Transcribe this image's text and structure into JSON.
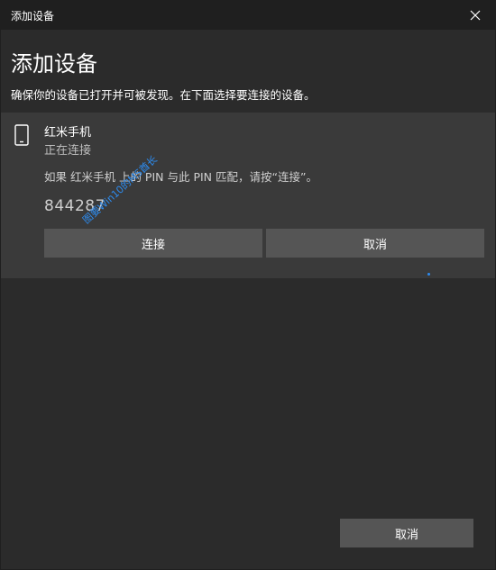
{
  "window": {
    "title": "添加设备"
  },
  "main": {
    "heading": "添加设备",
    "subheading": "确保你的设备已打开并可被发现。在下面选择要连接的设备。"
  },
  "device": {
    "name": "红米手机",
    "status": "正在连接",
    "pin_instruction": "如果 红米手机 上的 PIN 与此 PIN 匹配，请按“连接”。",
    "pin": "844287",
    "connect_label": "连接",
    "cancel_label": "取消"
  },
  "footer": {
    "cancel_label": "取消"
  },
  "watermark": {
    "text": "图要Win10的MS酋长"
  },
  "icons": {
    "close": "close-icon",
    "device": "phone-icon"
  },
  "colors": {
    "background": "#1f1f1f",
    "panel": "#2b2b2b",
    "card": "#3a3a3a",
    "button": "#555555",
    "watermark": "#2d8cf0"
  }
}
